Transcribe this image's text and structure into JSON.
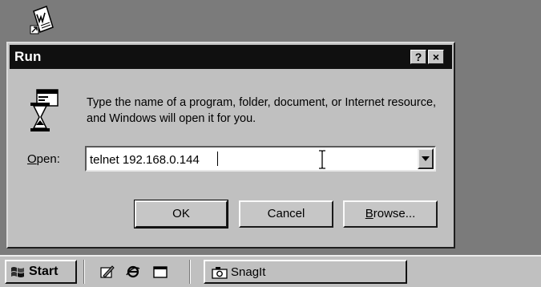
{
  "desktop": {
    "icon": "word-document-icon"
  },
  "dialog": {
    "title": "Run",
    "help_label": "?",
    "close_label": "×",
    "prompt": "Type the name of a program, folder, document, or Internet resource, and Windows will open it for you.",
    "open_label": "Open:",
    "open_value": "telnet 192.168.0.144",
    "ok_label": "OK",
    "cancel_label": "Cancel",
    "browse_label": "Browse..."
  },
  "taskbar": {
    "start_label": "Start",
    "quick_launch": [
      "desktop-edit-icon",
      "internet-explorer-icon",
      "show-desktop-icon"
    ],
    "task_label": "SnagIt"
  },
  "colors": {
    "titlebar": "#101010",
    "face": "#c0c0c0",
    "desktop": "#7b7b7b"
  }
}
